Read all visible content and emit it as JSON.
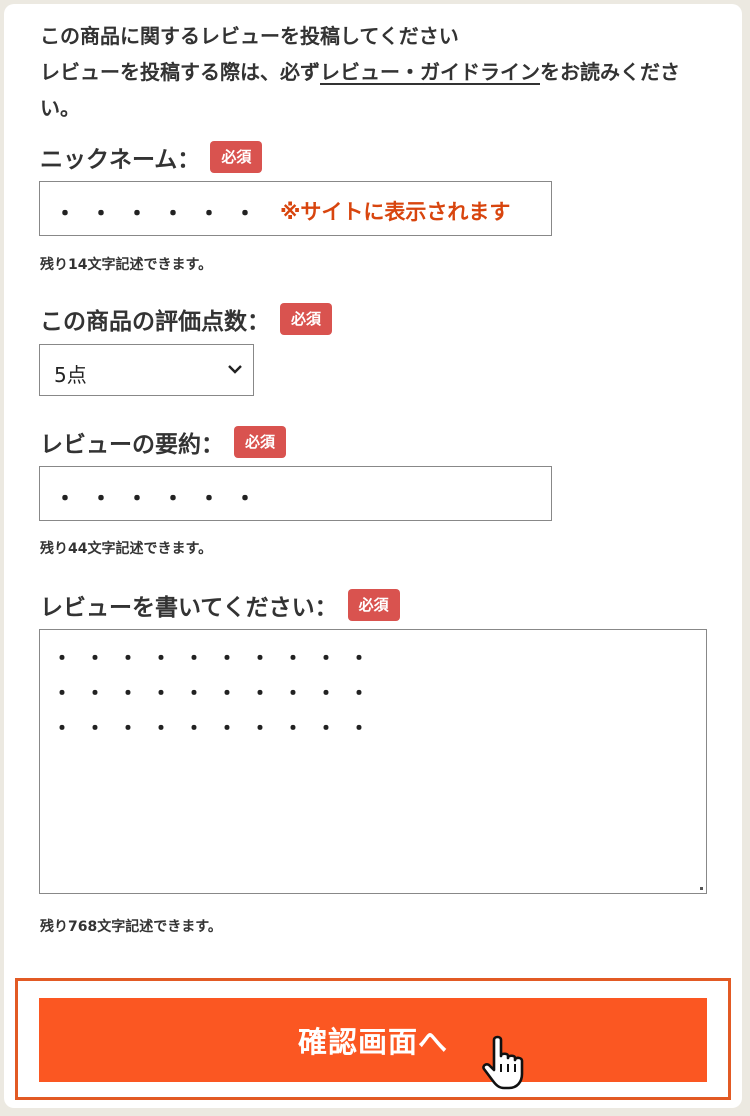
{
  "intro": {
    "line1": "この商品に関するレビューを投稿してください",
    "line2_prefix": "レビューを投稿する際は、必ず",
    "line2_link": "レビュー・ガイドライン",
    "line2_suffix": "をお読みくださ",
    "line3": "い。"
  },
  "required_badge": "必須",
  "nickname": {
    "label": "ニックネーム：",
    "value": "・・・・・・",
    "note": "※サイトに表示されます",
    "remaining": "残り14文字記述できます。"
  },
  "rating": {
    "label": "この商品の評価点数：",
    "selected": "5点"
  },
  "summary": {
    "label": "レビューの要約：",
    "value": "・・・・・・",
    "remaining": "残り44文字記述できます。"
  },
  "review": {
    "label": "レビューを書いてください：",
    "lines": [
      "・・・・・・・・・・",
      "・・・・・・・・・・",
      "・・・・・・・・・・"
    ],
    "remaining": "残り768文字記述できます。"
  },
  "submit": {
    "label": "確認画面へ"
  },
  "colors": {
    "accent": "#fb5722",
    "badge": "#d9534f",
    "note": "#d8450e"
  },
  "icons": {
    "select": "chevron-down-icon",
    "cursor": "hand-pointer-icon"
  }
}
